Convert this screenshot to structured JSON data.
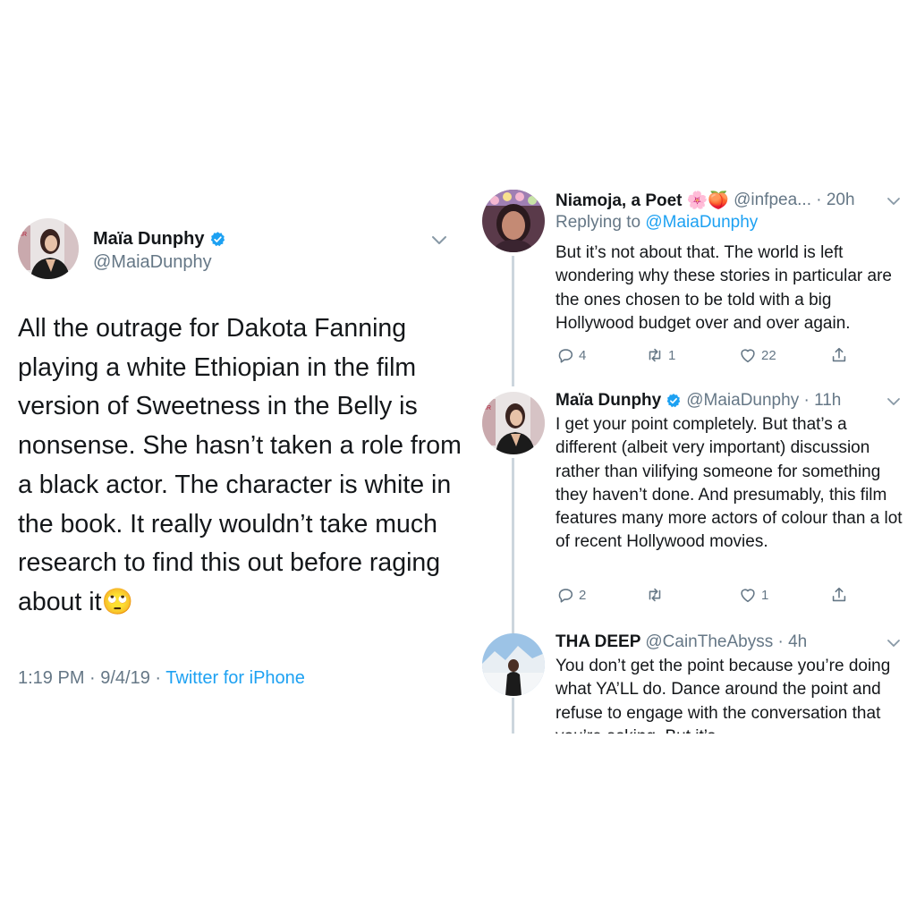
{
  "main_tweet": {
    "name": "Maïa Dunphy",
    "handle": "@MaiaDunphy",
    "text": "All the outrage for Dakota Fanning playing a white Ethiopian in the film version of Sweetness in the Belly is nonsense. She hasn’t taken a role from a black actor. The character is white in the book. It really wouldn’t take much research to find this out before raging about it🙄",
    "time": "1:19 PM · 9/4/19 · ",
    "source": "Twitter for iPhone"
  },
  "replies": [
    {
      "name": "Niamoja, a Poet 🌸🍑",
      "handle": "@infpea... · 20h",
      "replying_prefix": "Replying to ",
      "replying_to": "@MaiaDunphy",
      "text": "But it’s not about that. The world is left wondering why these stories in particular are the ones chosen to be told with a big Hollywood budget over and over again.",
      "replies_count": "4",
      "retweets_count": "1",
      "likes_count": "22"
    },
    {
      "name": "Maïa Dunphy",
      "handle": "@MaiaDunphy · 11h",
      "text": "I get your point completely. But that’s a different (albeit very important) discussion rather than vilifying someone for something they haven’t done. And presumably, this film features many more actors of colour than a lot of recent Hollywood movies.",
      "replies_count": "2",
      "retweets_count": "",
      "likes_count": "1"
    },
    {
      "name": "THA DEEP",
      "handle": "@CainTheAbyss · 4h",
      "text": "You don’t get the point because you’re doing what YA’LL do. Dance around the point and refuse to engage with the conversation that you’re asking. But it’s"
    }
  ],
  "colors": {
    "accent": "#1da1f2",
    "secondary_text": "#657786",
    "thread_line": "#ccd6dd"
  },
  "icons": [
    "verified-badge-icon",
    "chevron-down-icon",
    "reply-icon",
    "retweet-icon",
    "like-icon",
    "share-icon"
  ]
}
